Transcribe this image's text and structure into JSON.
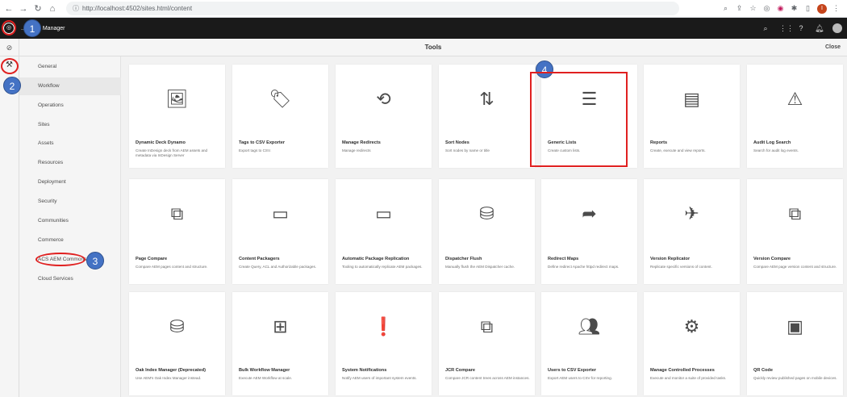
{
  "browser": {
    "url": "http://localhost:4502/sites.html/content",
    "profile_initial": "I"
  },
  "header": {
    "title": "...rience Manager"
  },
  "page": {
    "title": "Tools",
    "close_label": "Close"
  },
  "nav": {
    "items": [
      {
        "label": "General"
      },
      {
        "label": "Workflow"
      },
      {
        "label": "Operations"
      },
      {
        "label": "Sites"
      },
      {
        "label": "Assets"
      },
      {
        "label": "Resources"
      },
      {
        "label": "Deployment"
      },
      {
        "label": "Security"
      },
      {
        "label": "Communities"
      },
      {
        "label": "Commerce"
      },
      {
        "label": "ACS AEM Commons"
      },
      {
        "label": "Cloud Services"
      }
    ],
    "active_index": 1
  },
  "tools": [
    {
      "title": "Dynamic Deck Dynamo",
      "desc": "Create InDesign deck from AEM assets and metadata via InDesign Server",
      "icon": "image-icon"
    },
    {
      "title": "Tags to CSV Exporter",
      "desc": "Export tags to CSV.",
      "icon": "tag-icon"
    },
    {
      "title": "Manage Redirects",
      "desc": "Manage redirects",
      "icon": "redirect-icon"
    },
    {
      "title": "Sort Nodes",
      "desc": "Sort nodes by name or title",
      "icon": "sort-icon"
    },
    {
      "title": "Generic Lists",
      "desc": "Create custom lists.",
      "icon": "list-icon"
    },
    {
      "title": "Reports",
      "desc": "Create, execute and view reports.",
      "icon": "report-icon"
    },
    {
      "title": "Audit Log Search",
      "desc": "Search for audit log events.",
      "icon": "audit-icon"
    },
    {
      "title": "Page Compare",
      "desc": "Compare AEM pages content and structure.",
      "icon": "compare-icon"
    },
    {
      "title": "Content Packagers",
      "desc": "Create Query, ACL and Authorizable packages.",
      "icon": "box-icon"
    },
    {
      "title": "Automatic Package Replication",
      "desc": "Tooling to automatically replicate AEM packages.",
      "icon": "box-icon"
    },
    {
      "title": "Dispatcher Flush",
      "desc": "Manually flush the AEM Dispatcher cache.",
      "icon": "database-refresh-icon"
    },
    {
      "title": "Redirect Maps",
      "desc": "Define redirect Apache httpd redirect maps.",
      "icon": "share-arrow-icon"
    },
    {
      "title": "Version Replicator",
      "desc": "Replicate specific versions of content.",
      "icon": "send-clock-icon"
    },
    {
      "title": "Version Compare",
      "desc": "Compare AEM page version content and structure.",
      "icon": "compare-icon"
    },
    {
      "title": "Oak Index Manager (Deprecated)",
      "desc": "Use AEM's Oak Index Manager instead.",
      "icon": "database-icon"
    },
    {
      "title": "Bulk Workflow Manager",
      "desc": "Execute AEM Workflow at scale.",
      "icon": "workflow-icon"
    },
    {
      "title": "System Notifications",
      "desc": "Notify AEM users of important system events.",
      "icon": "alert-icon"
    },
    {
      "title": "JCR Compare",
      "desc": "Compare JCR content trees across AEM instances.",
      "icon": "compare-icon"
    },
    {
      "title": "Users to CSV Exporter",
      "desc": "Export AEM users to CSV for reporting.",
      "icon": "users-icon"
    },
    {
      "title": "Manage Controlled Processes",
      "desc": "Execute and monitor a suite of provided tasks.",
      "icon": "gears-icon"
    },
    {
      "title": "QR Code",
      "desc": "Quickly review published pages on mobile devices.",
      "icon": "qr-icon"
    }
  ],
  "annotations": [
    "1",
    "2",
    "3",
    "4"
  ],
  "colors": {
    "annotation_badge": "#4472c4",
    "annotation_outline": "#e02020",
    "header_bg": "#1a1a1a"
  }
}
